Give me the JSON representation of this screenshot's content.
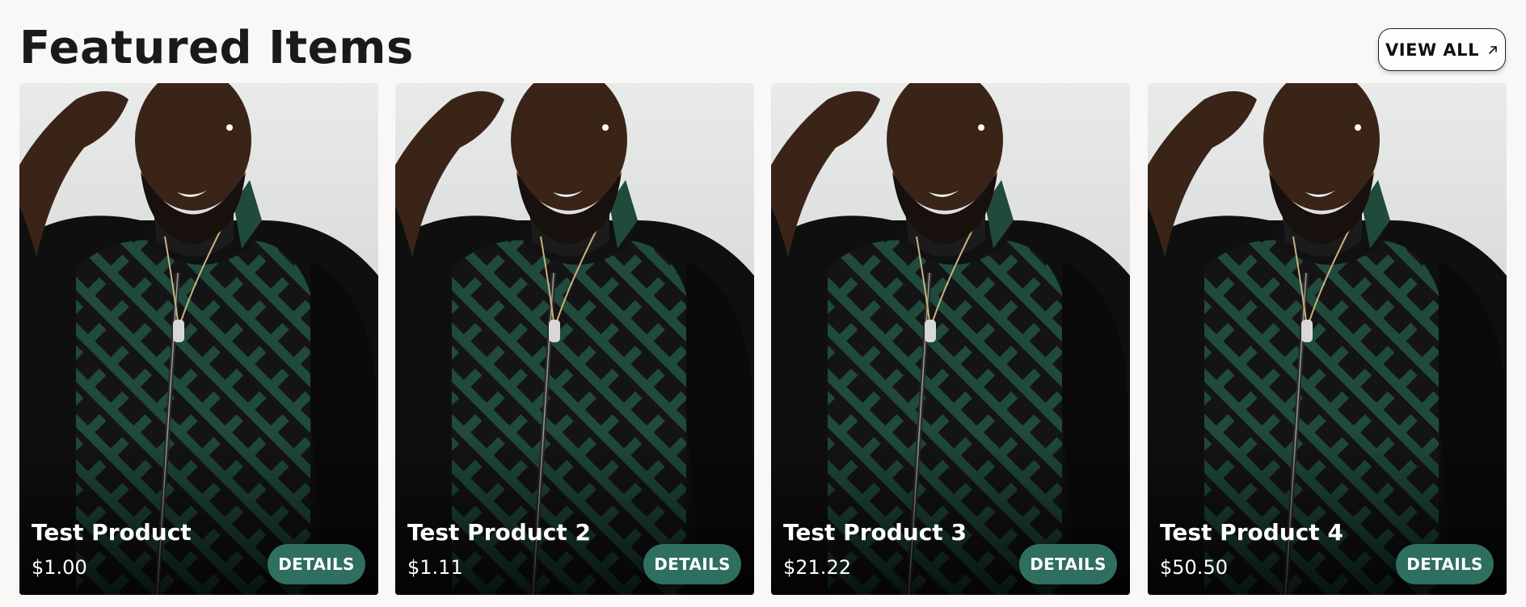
{
  "section": {
    "title": "Featured Items",
    "view_all_label": "VIEW ALL",
    "view_all_icon": "arrow-up-right-icon"
  },
  "products": [
    {
      "name": "Test Product",
      "price": "$1.00",
      "button_label": "DETAILS"
    },
    {
      "name": "Test Product 2",
      "price": "$1.11",
      "button_label": "DETAILS"
    },
    {
      "name": "Test Product 3",
      "price": "$21.22",
      "button_label": "DETAILS"
    },
    {
      "name": "Test Product 4",
      "price": "$50.50",
      "button_label": "DETAILS"
    }
  ],
  "colors": {
    "background": "#f9f8f6",
    "details_button": "#2f6f60",
    "jacket_green": "#1f4a3c"
  }
}
